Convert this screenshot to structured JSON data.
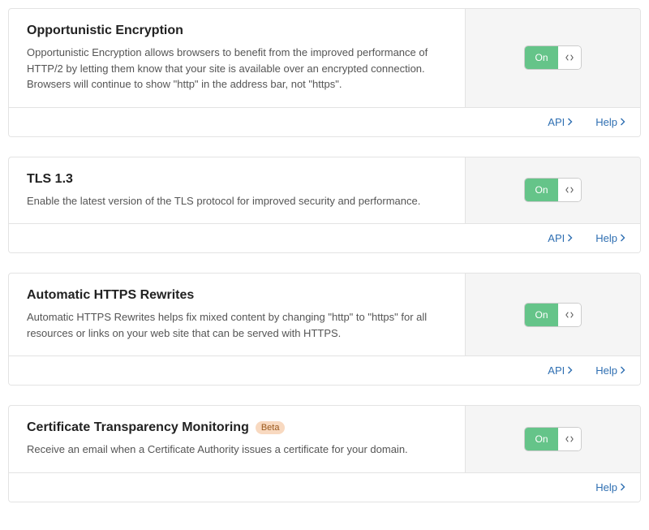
{
  "common": {
    "toggle_on": "On",
    "api": "API",
    "help": "Help"
  },
  "cards": [
    {
      "title": "Opportunistic Encryption",
      "desc": "Opportunistic Encryption allows browsers to benefit from the improved performance of HTTP/2 by letting them know that your site is available over an encrypted connection. Browsers will continue to show \"http\" in the address bar, not \"https\".",
      "toggle": "On",
      "badge": null,
      "show_api": true
    },
    {
      "title": "TLS 1.3",
      "desc": "Enable the latest version of the TLS protocol for improved security and performance.",
      "toggle": "On",
      "badge": null,
      "show_api": true
    },
    {
      "title": "Automatic HTTPS Rewrites",
      "desc": "Automatic HTTPS Rewrites helps fix mixed content by changing \"http\" to \"https\" for all resources or links on your web site that can be served with HTTPS.",
      "toggle": "On",
      "badge": null,
      "show_api": true
    },
    {
      "title": "Certificate Transparency Monitoring",
      "desc": "Receive an email when a Certificate Authority issues a certificate for your domain.",
      "toggle": "On",
      "badge": "Beta",
      "show_api": false
    }
  ]
}
